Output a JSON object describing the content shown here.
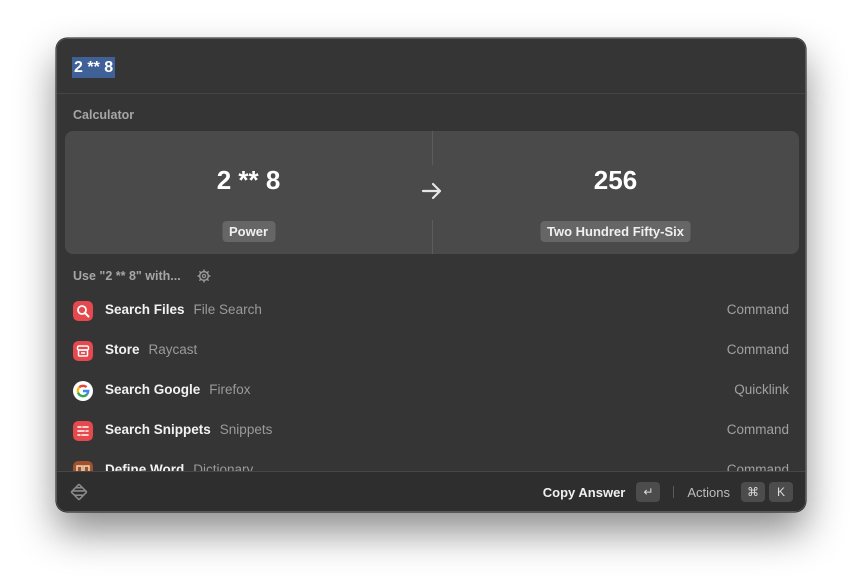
{
  "search": {
    "query": "2 ** 8"
  },
  "calculator": {
    "section_title": "Calculator",
    "expression": "2 ** 8",
    "expression_label": "Power",
    "result": "256",
    "result_label": "Two Hundred Fifty-Six"
  },
  "use_with": {
    "label": "Use \"2 ** 8\" with..."
  },
  "items": [
    {
      "title": "Search Files",
      "subtitle": "File Search",
      "type": "Command",
      "icon": "magnifier-icon",
      "color": "#e5484d"
    },
    {
      "title": "Store",
      "subtitle": "Raycast",
      "type": "Command",
      "icon": "store-icon",
      "color": "#e5484d"
    },
    {
      "title": "Search Google",
      "subtitle": "Firefox",
      "type": "Quicklink",
      "icon": "google-icon",
      "color": "#ffffff"
    },
    {
      "title": "Search Snippets",
      "subtitle": "Snippets",
      "type": "Command",
      "icon": "snippets-icon",
      "color": "#e5484d"
    },
    {
      "title": "Define Word",
      "subtitle": "Dictionary",
      "type": "Command",
      "icon": "dictionary-icon",
      "color": "#a0522d"
    }
  ],
  "footer": {
    "primary_action": "Copy Answer",
    "primary_key": "↵",
    "actions_label": "Actions",
    "actions_keys": [
      "⌘",
      "K"
    ]
  }
}
